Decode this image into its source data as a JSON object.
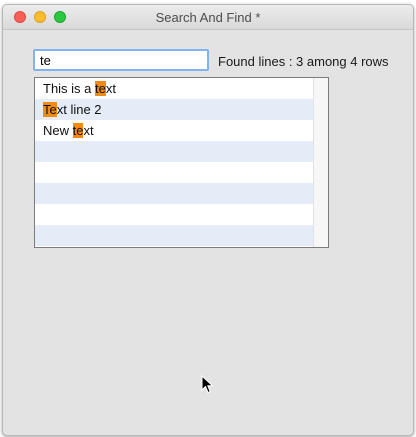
{
  "window": {
    "title": "Search And Find *"
  },
  "search": {
    "value": "te"
  },
  "status": {
    "text": "Found lines : 3 among 4 rows"
  },
  "table": {
    "rows": [
      {
        "before": "This is a ",
        "match": "te",
        "after": "xt"
      },
      {
        "before": "",
        "match": "Te",
        "after": "xt line 2"
      },
      {
        "before": "New ",
        "match": "te",
        "after": "xt"
      }
    ],
    "empty_rows": 5
  },
  "colors": {
    "highlight": "#f18b16",
    "alt_row": "#e5ecf7",
    "focus_ring": "#7fb3f2"
  },
  "icons": [
    "close-icon",
    "minimize-icon",
    "zoom-icon",
    "mouse-pointer-icon"
  ]
}
